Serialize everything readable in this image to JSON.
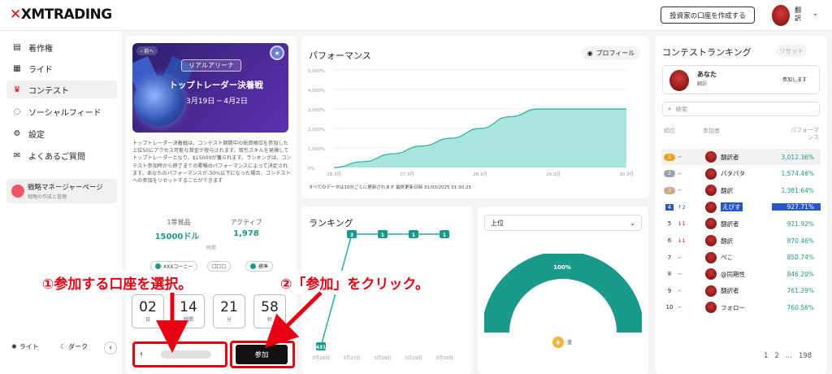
{
  "header": {
    "logo": "XMTRADING",
    "cta": "投資家の口座を作成する",
    "user_line1": "翻",
    "user_line2": "訳"
  },
  "sidebar": {
    "items": [
      {
        "label": "着作権",
        "icon": "briefcase-icon",
        "glyph": "▤"
      },
      {
        "label": "ライド",
        "icon": "calendar-icon",
        "glyph": "▦"
      },
      {
        "label": "コンテスト",
        "icon": "trophy-icon",
        "glyph": "♛"
      },
      {
        "label": "ソーシャルフィード",
        "icon": "feed-icon",
        "glyph": "◌"
      },
      {
        "label": "設定",
        "icon": "gear-icon",
        "glyph": "⚙"
      },
      {
        "label": "よくあるご質問",
        "icon": "chat-icon",
        "glyph": "✉"
      }
    ],
    "manager": {
      "title": "戦略マネージャーページ",
      "subtitle": "戦略の作成と管理"
    },
    "light": "ライト",
    "dark": "ダーク"
  },
  "contest": {
    "back": "‹ 前へ",
    "arena": "リアルアリーナ",
    "title": "トップトレーダー決着戦",
    "dates": "3月19日 ─ 4月2日",
    "description": "トップトレーダー決着戦は、コンテスト期間中の総資格位を参加した上位50にアクセス可能な賞金が授与されます。取引スキルを発揮してトップトレーダーとなり、$15000が獲られます。ランキングは、コンテスト参加時から終了までの累積のパフォーマンスによって決定されます。あなたのパフォーマンスが-30%以下になった場合、コンテストへの参加をリセットすることができます",
    "prize_label": "1等賞品",
    "prize_value": "15000ドル",
    "active_label": "アクティブ",
    "active_value": "1,978",
    "timer_label": "時間",
    "chip1": "XXXコーニー",
    "chip2": "□□□",
    "chip3": "標準",
    "timer": [
      {
        "n": "02",
        "u": "日"
      },
      {
        "n": "14",
        "u": "時間"
      },
      {
        "n": "21",
        "u": "分"
      },
      {
        "n": "58",
        "u": "秒"
      }
    ],
    "join": "参加"
  },
  "performance": {
    "title": "パフォーマンス",
    "profile": "プロフィール",
    "note": "すべてのデータは10分ごとに更新されます 最終更新日時 31/03/2025 01:30:25"
  },
  "ranking_panel": {
    "title": "ランキング"
  },
  "top_panel": {
    "select": "上位",
    "gauge": "100%",
    "coin_label": "金"
  },
  "leaderboard": {
    "title": "コンテストランキング",
    "reset": "リセット",
    "me": {
      "name": "あなた",
      "sub": "翻訳",
      "status": "参加します"
    },
    "search": "検索",
    "headers": {
      "rank": "順位",
      "participant": "参加者",
      "perf": "パフォーマンス"
    },
    "rows": [
      {
        "pos": "1",
        "change": "−",
        "name": "翻訳者",
        "value": "3,012.36%",
        "badge": "gold"
      },
      {
        "pos": "2",
        "change": "−",
        "name": "パタパタ",
        "value": "1,574.46%",
        "badge": "silver"
      },
      {
        "pos": "3",
        "change": "−",
        "name": "翻訳",
        "value": "1,381.64%",
        "badge": "bronze"
      },
      {
        "pos": "4",
        "change": "↑2",
        "name": "えびす",
        "value": "927.71%",
        "highlight": true
      },
      {
        "pos": "5",
        "change": "↓1",
        "name": "翻訳者",
        "value": "921.92%"
      },
      {
        "pos": "6",
        "change": "↓1",
        "name": "翻訳",
        "value": "870.46%"
      },
      {
        "pos": "7",
        "change": "−",
        "name": "ぺこ",
        "value": "850.74%"
      },
      {
        "pos": "8",
        "change": "−",
        "name": "@同期性",
        "value": "846.20%"
      },
      {
        "pos": "9",
        "change": "−",
        "name": "翻訳者",
        "value": "761.29%"
      },
      {
        "pos": "10",
        "change": "−",
        "name": "フォロー",
        "value": "760.56%"
      }
    ],
    "pager": [
      "1",
      "2",
      "...",
      "198"
    ]
  },
  "annotations": {
    "a1": "①参加する口座を選択。",
    "a2": "②「参加」をクリック。"
  },
  "colors": {
    "teal": "#1a9a8a",
    "accent": "#e60012",
    "area": "#9fe0d6"
  },
  "chart_data": [
    {
      "type": "area",
      "title": "パフォーマンス",
      "x": [
        "28.3月",
        "",
        "27.3月",
        "",
        "28.3月",
        "",
        "29.3月",
        "",
        "30.3月"
      ],
      "yticks": [
        "5,000%",
        "4,000%",
        "3,000%",
        "2,000%",
        "1,000%",
        "0%"
      ],
      "ylim": [
        0,
        5000
      ],
      "values": [
        0,
        300,
        700,
        1100,
        1500,
        2000,
        2600,
        3000,
        3000,
        3000,
        3000
      ]
    },
    {
      "type": "line",
      "title": "ランキング",
      "x": [
        "3月26日",
        "3月27日",
        "3月28日",
        "3月29日",
        "3月30日"
      ],
      "series": [
        {
          "points": [
            {
              "x": "3月26日",
              "label": "431"
            },
            {
              "x": "3月27日",
              "label": "3"
            },
            {
              "x": "3月28日",
              "label": "1"
            },
            {
              "x": "3月29日",
              "label": "1"
            },
            {
              "x": "3月30日",
              "label": "1"
            }
          ]
        }
      ]
    }
  ]
}
